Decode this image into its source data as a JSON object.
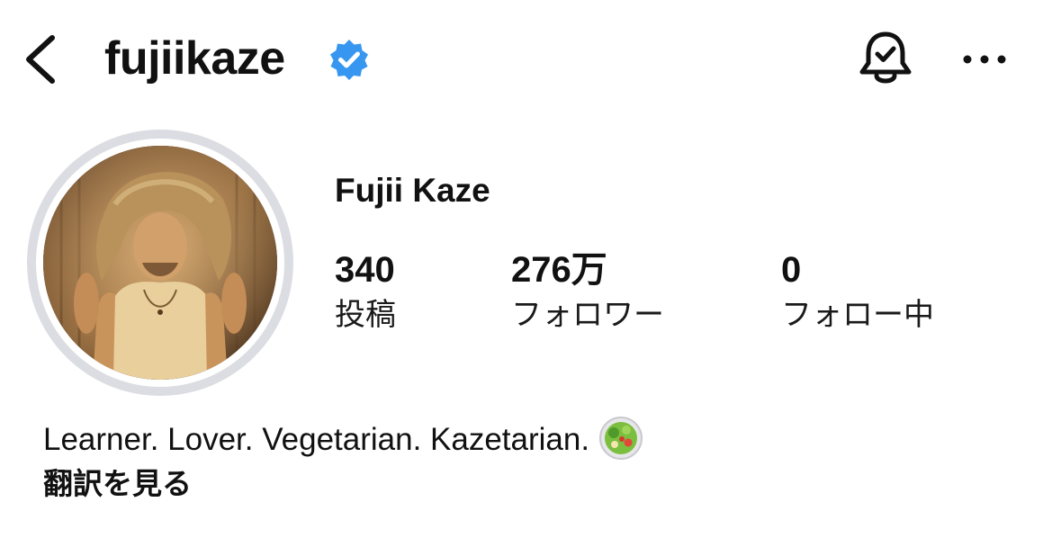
{
  "header": {
    "username": "fujiikaze",
    "verified": true,
    "verified_color": "#3797f0",
    "back_icon": "chevron-left-icon",
    "bell_icon": "bell-check-icon",
    "more_icon": "ellipsis-horizontal-icon"
  },
  "profile": {
    "display_name": "Fujii Kaze",
    "avatar_icon": "profile-photo",
    "stats": [
      {
        "value": "340",
        "label": "投稿"
      },
      {
        "value": "276万",
        "label": "フォロワー"
      },
      {
        "value": "0",
        "label": "フォロー中"
      }
    ]
  },
  "bio": {
    "text": "Learner. Lover. Vegetarian. Kazetarian.",
    "emoji_icon": "salad-emoji",
    "translate_label": "翻訳を見る"
  }
}
